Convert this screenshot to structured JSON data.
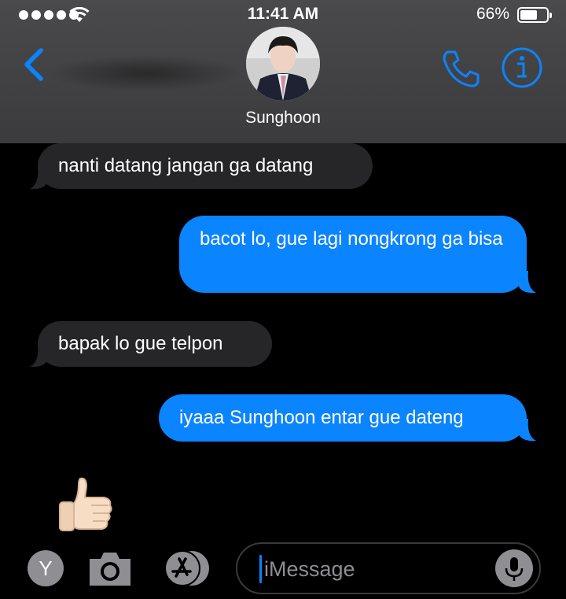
{
  "status_bar": {
    "time": "11:41 AM",
    "battery": "66%",
    "battery_level": 0.66
  },
  "header": {
    "contact_name": "Sunghoon"
  },
  "messages": [
    {
      "direction": "received",
      "text": "nanti datang jangan ga datang"
    },
    {
      "direction": "sent",
      "text": "bacot lo, gue lagi nongkrong ga bisa"
    },
    {
      "direction": "received",
      "text": "bapak lo gue telpon"
    },
    {
      "direction": "sent",
      "text": "iyaaa Sunghoon entar gue dateng"
    },
    {
      "direction": "received",
      "text": "👍🏻"
    }
  ],
  "input_bar": {
    "apps_button_label": "Y",
    "placeholder": "iMessage"
  },
  "colors": {
    "sent_bubble": "#0b84ff",
    "received_bubble": "#262628",
    "accent": "#0b84ff"
  }
}
